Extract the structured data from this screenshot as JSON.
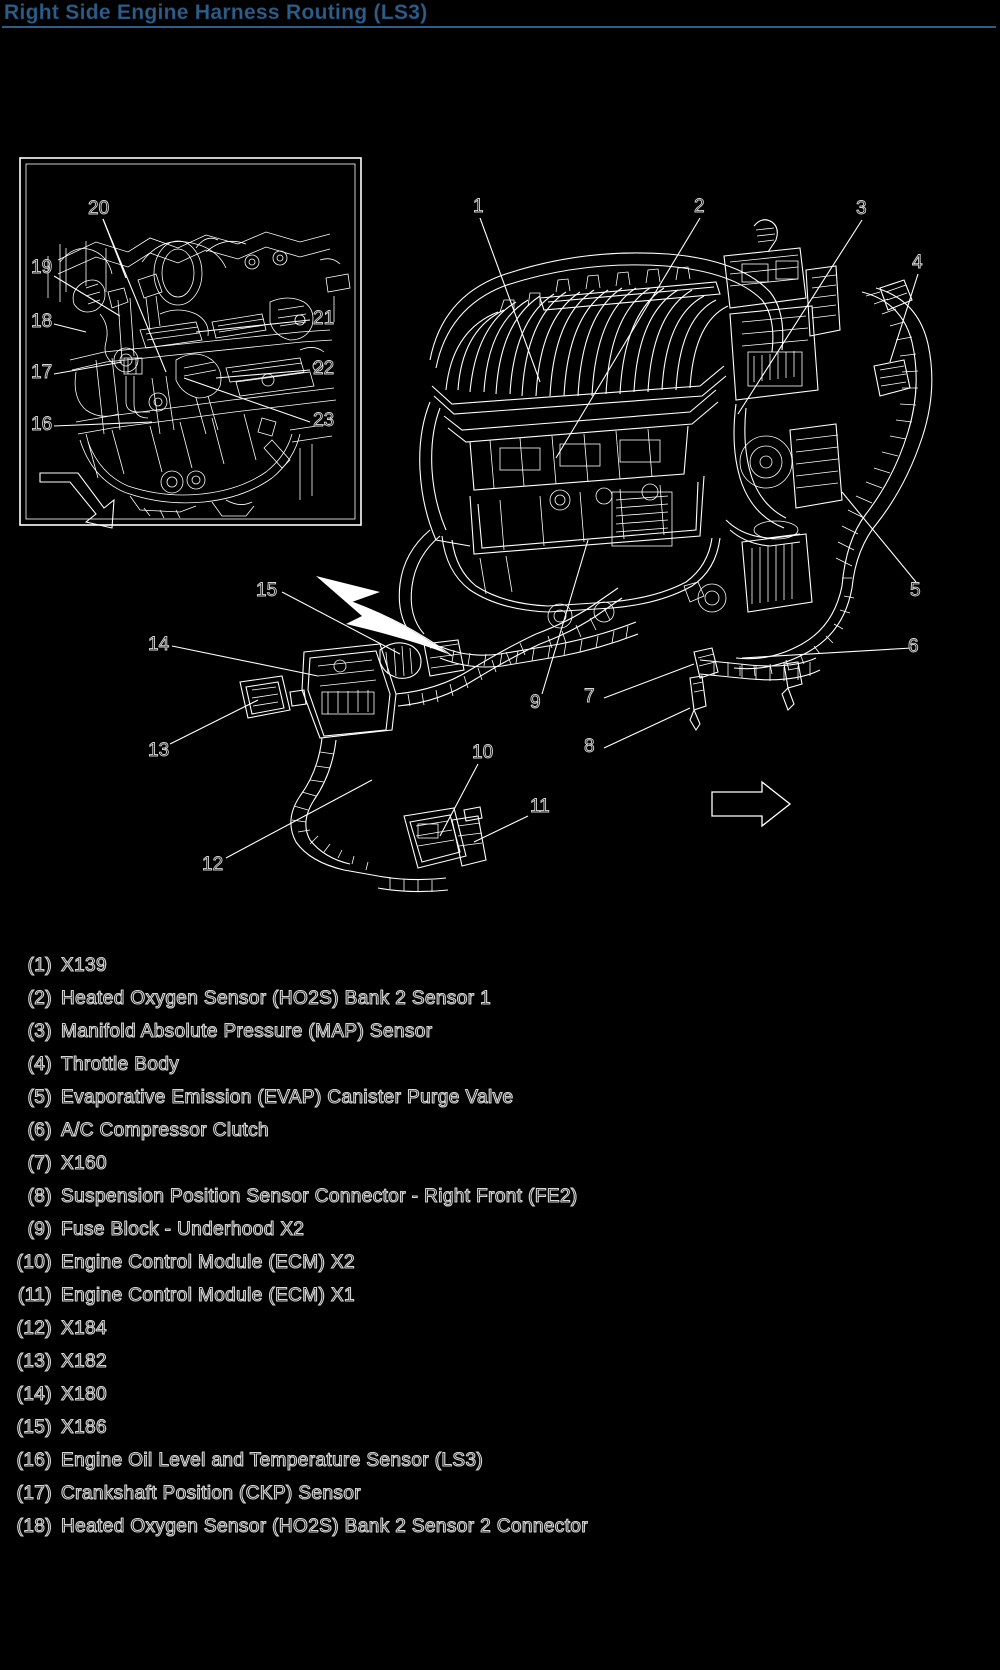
{
  "document": {
    "title": "Right Side Engine Harness Routing (LS3)",
    "title_color": "#2e5d87",
    "background_color": "#000000",
    "line_art_color": "#ffffff"
  },
  "diagram": {
    "name": "right-side-engine-harness-routing",
    "inset_panel": {
      "name": "lower-engine-detail-inset",
      "callouts": [
        "16",
        "17",
        "18",
        "19",
        "20",
        "21",
        "22",
        "23"
      ],
      "direction_arrow": "arrow-down-left"
    },
    "main_view": {
      "name": "engine-assembly-view",
      "callouts": [
        "1",
        "2",
        "3",
        "4",
        "5",
        "6",
        "7",
        "8",
        "9",
        "10",
        "11",
        "12",
        "13",
        "14",
        "15"
      ],
      "curved_arrow": "arrow-curved-up-left",
      "direction_arrow": "arrow-right"
    }
  },
  "legend": {
    "name": "component-legend",
    "items": [
      {
        "index": "(1)",
        "label": "X139"
      },
      {
        "index": "(2)",
        "label": "Heated Oxygen Sensor (HO2S) Bank 2 Sensor 1"
      },
      {
        "index": "(3)",
        "label": "Manifold Absolute Pressure (MAP) Sensor"
      },
      {
        "index": "(4)",
        "label": "Throttle Body"
      },
      {
        "index": "(5)",
        "label": "Evaporative Emission (EVAP) Canister Purge Valve"
      },
      {
        "index": "(6)",
        "label": "A/C Compressor Clutch"
      },
      {
        "index": "(7)",
        "label": "X160"
      },
      {
        "index": "(8)",
        "label": "Suspension Position Sensor Connector - Right Front (FE2)"
      },
      {
        "index": "(9)",
        "label": "Fuse Block - Underhood X2"
      },
      {
        "index": "(10)",
        "label": "Engine Control Module (ECM) X2"
      },
      {
        "index": "(11)",
        "label": "Engine Control Module (ECM) X1"
      },
      {
        "index": "(12)",
        "label": "X184"
      },
      {
        "index": "(13)",
        "label": "X182"
      },
      {
        "index": "(14)",
        "label": "X180"
      },
      {
        "index": "(15)",
        "label": "X186"
      },
      {
        "index": "(16)",
        "label": "Engine Oil Level and Temperature Sensor (LS3)"
      },
      {
        "index": "(17)",
        "label": "Crankshaft Position (CKP) Sensor"
      },
      {
        "index": "(18)",
        "label": "Heated Oxygen Sensor (HO2S) Bank 2 Sensor 2 Connector"
      }
    ]
  },
  "callout_numbers": {
    "n1": "1",
    "n2": "2",
    "n3": "3",
    "n4": "4",
    "n5": "5",
    "n6": "6",
    "n7": "7",
    "n8": "8",
    "n9": "9",
    "n10": "10",
    "n11": "11",
    "n12": "12",
    "n13": "13",
    "n14": "14",
    "n15": "15",
    "n16": "16",
    "n17": "17",
    "n18": "18",
    "n19": "19",
    "n20": "20",
    "n21": "21",
    "n22": "22",
    "n23": "23"
  }
}
